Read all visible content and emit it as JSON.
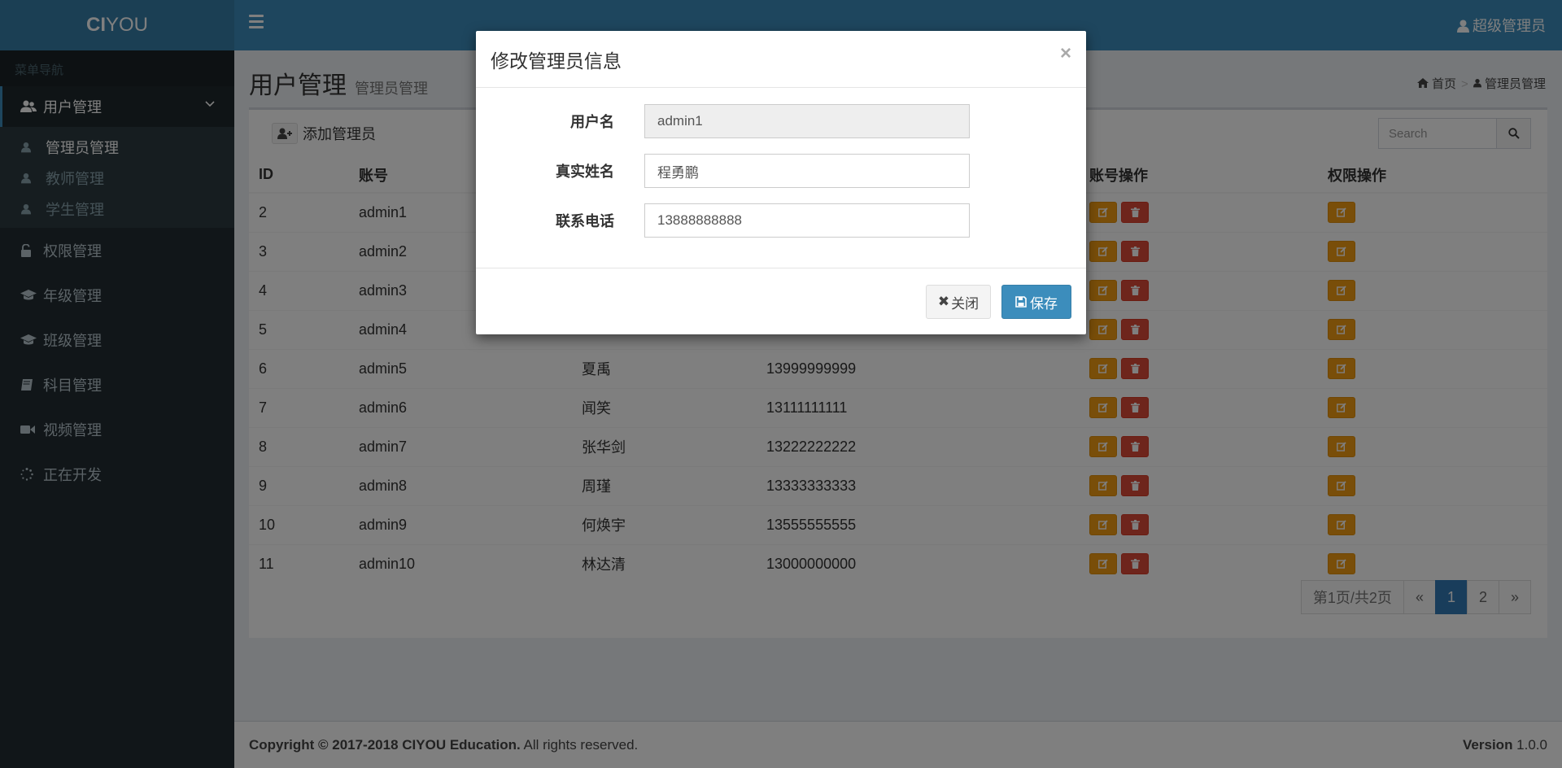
{
  "logo": {
    "bold": "CI",
    "rest": "YOU"
  },
  "header": {
    "user": "超级管理员"
  },
  "sidebar": {
    "header": "菜单导航",
    "items": [
      {
        "label": "用户管理",
        "icon": "users-icon"
      },
      {
        "label": "权限管理",
        "icon": "unlock-icon"
      },
      {
        "label": "年级管理",
        "icon": "graduation-cap-icon"
      },
      {
        "label": "班级管理",
        "icon": "graduation-cap-icon"
      },
      {
        "label": "科目管理",
        "icon": "book-icon"
      },
      {
        "label": "视频管理",
        "icon": "video-camera-icon"
      },
      {
        "label": "正在开发",
        "icon": "spinner-icon"
      }
    ],
    "submenu": [
      {
        "label": "管理员管理"
      },
      {
        "label": "教师管理"
      },
      {
        "label": "学生管理"
      }
    ]
  },
  "content": {
    "title": "用户管理",
    "subtitle": "管理员管理",
    "breadcrumb": {
      "home": "首页",
      "current": "管理员管理"
    },
    "add_button": "添加管理员",
    "search_placeholder": "Search"
  },
  "table": {
    "headers": {
      "id": "ID",
      "account": "账号",
      "name": "",
      "phone": "",
      "account_ops": "账号操作",
      "perm_ops": "权限操作"
    },
    "rows": [
      {
        "id": "2",
        "account": "admin1",
        "name": "",
        "phone": ""
      },
      {
        "id": "3",
        "account": "admin2",
        "name": "",
        "phone": ""
      },
      {
        "id": "4",
        "account": "admin3",
        "name": "",
        "phone": ""
      },
      {
        "id": "5",
        "account": "admin4",
        "name": "",
        "phone": ""
      },
      {
        "id": "6",
        "account": "admin5",
        "name": "夏禹",
        "phone": "13999999999"
      },
      {
        "id": "7",
        "account": "admin6",
        "name": "闻笑",
        "phone": "13111111111"
      },
      {
        "id": "8",
        "account": "admin7",
        "name": "张华剑",
        "phone": "13222222222"
      },
      {
        "id": "9",
        "account": "admin8",
        "name": "周瑾",
        "phone": "13333333333"
      },
      {
        "id": "10",
        "account": "admin9",
        "name": "何焕宇",
        "phone": "13555555555"
      },
      {
        "id": "11",
        "account": "admin10",
        "name": "林达清",
        "phone": "13000000000"
      }
    ]
  },
  "pagination": {
    "info": "第1页/共2页",
    "prev": "«",
    "pages": [
      "1",
      "2"
    ],
    "next": "»"
  },
  "footer": {
    "copyright_bold": "Copyright © 2017-2018 CIYOU Education.",
    "copyright_rest": " All rights reserved.",
    "version_label": "Version",
    "version": " 1.0.0"
  },
  "modal": {
    "title": "修改管理员信息",
    "close_symbol": "×",
    "fields": {
      "username_label": "用户名",
      "username_value": "admin1",
      "realname_label": "真实姓名",
      "realname_value": "程勇鹏",
      "phone_label": "联系电话",
      "phone_value": "13888888888"
    },
    "close_button": "关闭",
    "close_mark": "✖",
    "save_button": "保存"
  },
  "colors": {
    "brand": "#3c8dbc",
    "warning": "#f39c12",
    "danger": "#dd4b39",
    "sidebar": "#222d32"
  }
}
